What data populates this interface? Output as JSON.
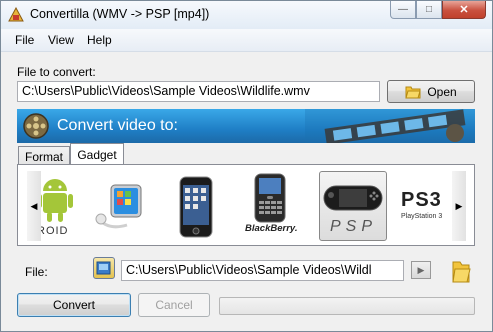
{
  "window": {
    "title": "Convertilla  (WMV -> PSP [mp4])"
  },
  "menu": {
    "file": "File",
    "view": "View",
    "help": "Help"
  },
  "input": {
    "label": "File to convert:",
    "value": "C:\\Users\\Public\\Videos\\Sample Videos\\Wildlife.wmv",
    "open_label": "Open"
  },
  "banner": {
    "text": "Convert video to:"
  },
  "tabs": [
    {
      "label": "Format",
      "active": false
    },
    {
      "label": "Gadget",
      "active": true
    }
  ],
  "devices": [
    {
      "name": "android",
      "text": "ROID"
    },
    {
      "name": "ipod-nano",
      "text": ""
    },
    {
      "name": "ipod-touch",
      "text": ""
    },
    {
      "name": "blackberry",
      "text": "BlackBerry."
    },
    {
      "name": "psp",
      "text": "PSP",
      "selected": true
    },
    {
      "name": "ps3",
      "text": "PS3",
      "subtext": "PlayStation 3"
    }
  ],
  "output": {
    "label": "File:",
    "value": "C:\\Users\\Public\\Videos\\Sample Videos\\Wildl"
  },
  "actions": {
    "convert_label": "Convert",
    "cancel_label": "Cancel"
  },
  "progress": {
    "value": 0
  }
}
